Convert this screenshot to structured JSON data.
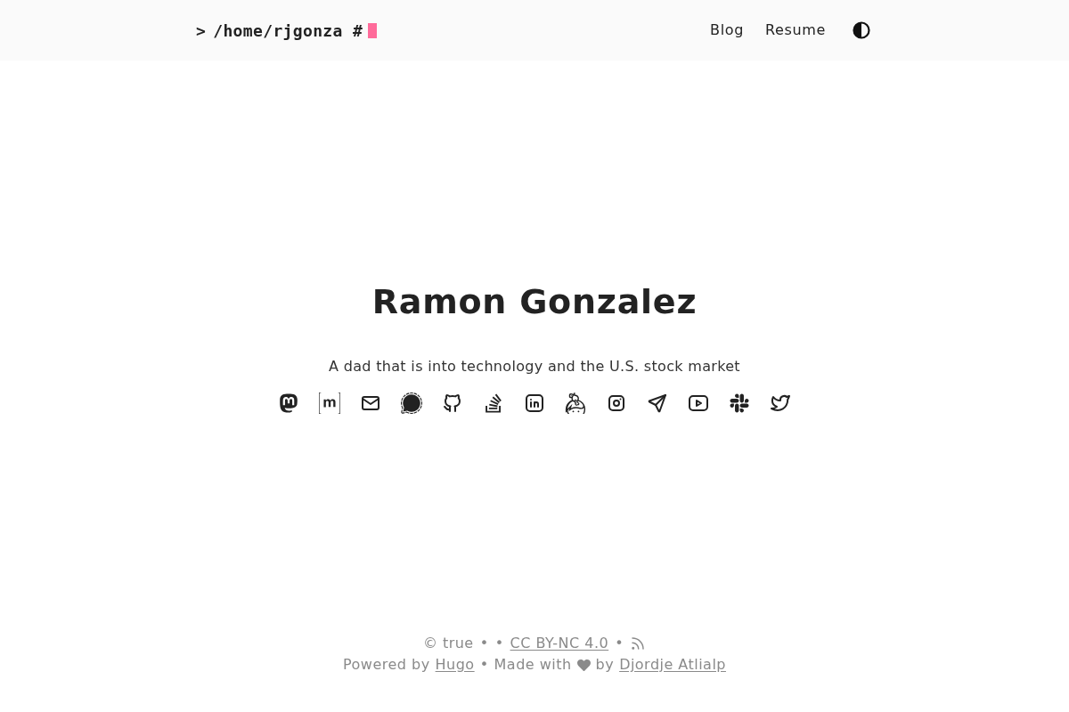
{
  "header": {
    "logo": {
      "prompt": ">",
      "path": "/home/rjgonza #"
    },
    "nav": [
      {
        "label": "Blog"
      },
      {
        "label": "Resume"
      }
    ]
  },
  "profile": {
    "name": "Ramon Gonzalez",
    "tagline": "A dad that is into technology and the U.S. stock market",
    "social_links": [
      {
        "kind": "mastodon"
      },
      {
        "kind": "matrix"
      },
      {
        "kind": "email"
      },
      {
        "kind": "signal"
      },
      {
        "kind": "github"
      },
      {
        "kind": "stackoverflow"
      },
      {
        "kind": "linkedin"
      },
      {
        "kind": "keybase"
      },
      {
        "kind": "instagram"
      },
      {
        "kind": "telegram"
      },
      {
        "kind": "youtube"
      },
      {
        "kind": "slack"
      },
      {
        "kind": "twitter"
      }
    ]
  },
  "footer": {
    "line_1": [
      {
        "kind": "text",
        "text": "© true"
      },
      {
        "kind": "separator",
        "text": "•"
      },
      {
        "kind": "separator",
        "text": "•"
      },
      {
        "kind": "link",
        "text": "CC BY-NC 4.0"
      },
      {
        "kind": "separator",
        "text": "•"
      },
      {
        "kind": "rss"
      }
    ],
    "line_2": [
      {
        "kind": "text",
        "text": "Powered by"
      },
      {
        "kind": "link",
        "text": "Hugo"
      },
      {
        "kind": "separator",
        "text": "•"
      },
      {
        "kind": "text",
        "text": "Made with"
      },
      {
        "kind": "heart"
      },
      {
        "kind": "text",
        "text": "by"
      },
      {
        "kind": "link",
        "text": "Djordje Atlialp"
      }
    ]
  }
}
